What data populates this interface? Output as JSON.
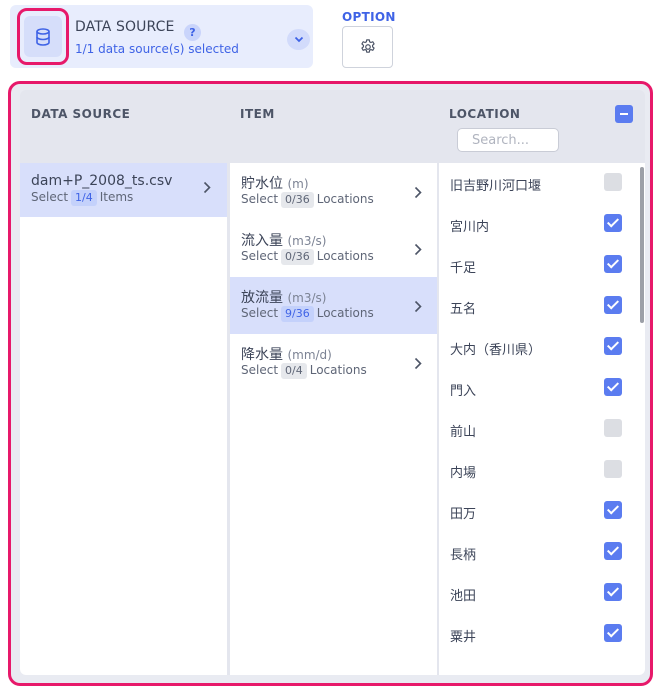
{
  "datasource_card": {
    "title": "DATA SOURCE",
    "help": "?",
    "subtitle": "1/1 data source(s) selected",
    "icon": "database-icon",
    "expand_icon": "chevron-down-icon"
  },
  "option": {
    "label": "OPTION",
    "icon": "gear-icon"
  },
  "columns": {
    "data_source_header": "DATA SOURCE",
    "item_header": "ITEM",
    "location_header": "LOCATION",
    "search_placeholder": "Search..."
  },
  "data_sources": [
    {
      "name": "dam+P_2008_ts.csv",
      "select": "Select",
      "count": "1/4",
      "suffix": "Items"
    }
  ],
  "items": [
    {
      "name": "貯水位",
      "unit": "(m)",
      "select": "Select",
      "count": "0/36",
      "suffix": "Locations"
    },
    {
      "name": "流入量",
      "unit": "(m3/s)",
      "select": "Select",
      "count": "0/36",
      "suffix": "Locations"
    },
    {
      "name": "放流量",
      "unit": "(m3/s)",
      "select": "Select",
      "count": "9/36",
      "suffix": "Locations"
    },
    {
      "name": "降水量",
      "unit": "(mm/d)",
      "select": "Select",
      "count": "0/4",
      "suffix": "Locations"
    }
  ],
  "locations": [
    {
      "name": "旧吉野川河口堰",
      "checked": false
    },
    {
      "name": "宮川内",
      "checked": true
    },
    {
      "name": "千足",
      "checked": true
    },
    {
      "name": "五名",
      "checked": true
    },
    {
      "name": "大内（香川県）",
      "checked": true
    },
    {
      "name": "門入",
      "checked": true
    },
    {
      "name": "前山",
      "checked": false
    },
    {
      "name": "内場",
      "checked": false
    },
    {
      "name": "田万",
      "checked": true
    },
    {
      "name": "長柄",
      "checked": true
    },
    {
      "name": "池田",
      "checked": true
    },
    {
      "name": "粟井",
      "checked": true
    }
  ],
  "colors": {
    "accent": "#3f63e6",
    "checkbox_on": "#5b7cf0",
    "highlight": "#e7196a",
    "selected_row": "#d8dffb"
  }
}
